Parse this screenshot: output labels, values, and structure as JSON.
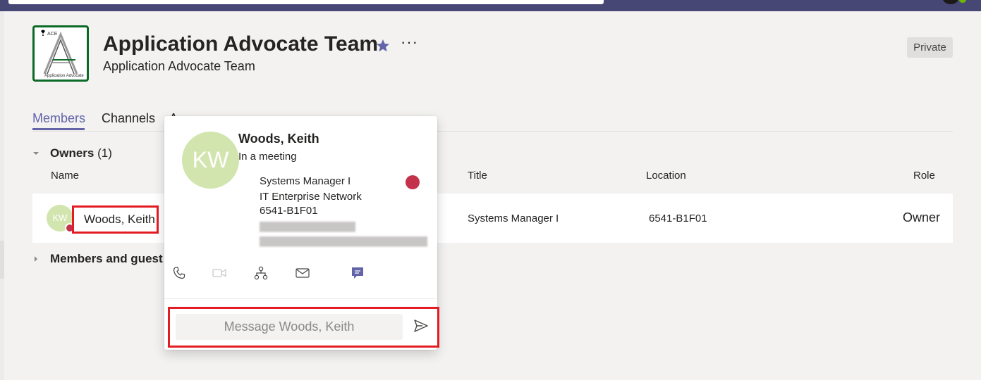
{
  "team": {
    "title": "Application Advocate Team",
    "subtitle": "Application Advocate Team",
    "privacy_badge": "Private",
    "more_label": "···",
    "logo_text_top": "ACE",
    "logo_text_bottom": "Application Advocate"
  },
  "tabs": [
    {
      "label": "Members",
      "selected": true
    },
    {
      "label": "Channels",
      "selected": false
    },
    {
      "label": "A",
      "selected": false
    }
  ],
  "owners_section": {
    "heading": "Owners",
    "count": "(1)",
    "columns": {
      "name": "Name",
      "title": "Title",
      "location": "Location",
      "role": "Role"
    },
    "rows": [
      {
        "initials": "KW",
        "name": "Woods, Keith",
        "title": "Systems Manager I",
        "location": "6541-B1F01",
        "role": "Owner"
      }
    ]
  },
  "members_section": {
    "heading": "Members and guest"
  },
  "profile_card": {
    "initials": "KW",
    "name": "Woods, Keith",
    "status": "In a meeting",
    "job_title": "Systems Manager I",
    "department": "IT Enterprise Network",
    "office": "6541-B1F01",
    "message_placeholder": "Message Woods, Keith",
    "actions": [
      "phone-icon",
      "video-icon",
      "org-chart-icon",
      "mail-icon",
      "chat-icon"
    ]
  },
  "colors": {
    "accent": "#6264a7",
    "busy": "#c4314b",
    "highlight_box": "#e31b23",
    "avatar_bg": "#d3e5ae",
    "topbar": "#464775"
  }
}
